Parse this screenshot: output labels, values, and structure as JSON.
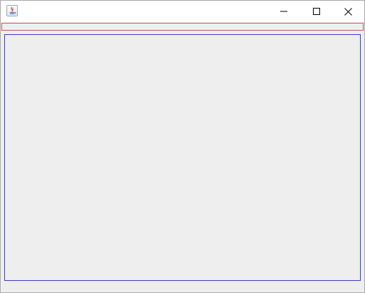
{
  "window": {
    "title": "",
    "app_icon": "java-coffee-cup-icon",
    "controls": {
      "minimize_icon": "minimize-icon",
      "maximize_icon": "maximize-icon",
      "close_icon": "close-icon"
    }
  },
  "colors": {
    "client_background": "#eeeeee",
    "top_strip_border": "#c85a5a",
    "main_panel_border": "#3c3cc8"
  }
}
